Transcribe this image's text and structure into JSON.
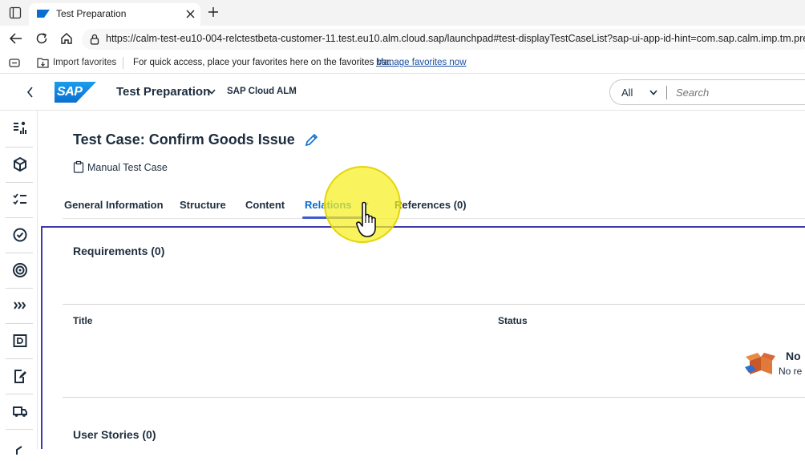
{
  "browser": {
    "tab_title": "Test Preparation",
    "url": "https://calm-test-eu10-004-relctestbeta-customer-11.test.eu10.alm.cloud.sap/launchpad#test-displayTestCaseList?sap-ui-app-id-hint=com.sap.calm.imp.tm.prepa",
    "favorites": {
      "import_label": "Import favorites",
      "hint": "For quick access, place your favorites here on the favorites bar.",
      "manage_link": "Manage favorites now"
    }
  },
  "shell": {
    "logo_text": "SAP",
    "app_title": "Test Preparation",
    "product_name": "SAP Cloud ALM",
    "search": {
      "scope": "All",
      "placeholder": "Search"
    }
  },
  "page": {
    "title": "Test Case: Confirm Goods Issue",
    "subtitle": "Manual Test Case",
    "tabs": [
      {
        "label": "General Information",
        "active": false
      },
      {
        "label": "Structure",
        "active": false
      },
      {
        "label": "Content",
        "active": false
      },
      {
        "label": "Relations",
        "active": true
      },
      {
        "label": "References (0)",
        "active": false
      }
    ]
  },
  "requirements": {
    "title": "Requirements (0)",
    "columns": [
      "Title",
      "Status"
    ],
    "empty_title": "No",
    "empty_text": "No re"
  },
  "user_stories": {
    "title": "User Stories (0)"
  },
  "colors": {
    "accent": "#0a6ed1",
    "section_border": "#3d3aa9",
    "highlight": "#f6f01e"
  }
}
